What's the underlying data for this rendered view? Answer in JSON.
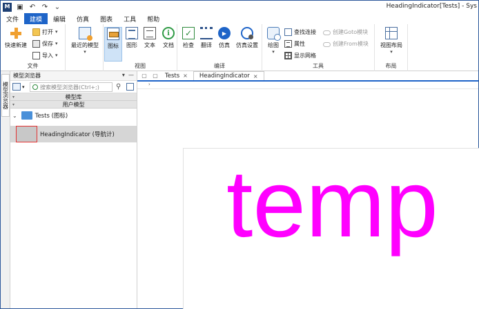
{
  "window": {
    "title": "HeadingIndicator[Tests] - Sys",
    "logo_letter": "M"
  },
  "menu": {
    "tabs": [
      {
        "label": "文件"
      },
      {
        "label": "建模"
      },
      {
        "label": "编辑"
      },
      {
        "label": "仿真"
      },
      {
        "label": "图表"
      },
      {
        "label": "工具"
      },
      {
        "label": "帮助"
      }
    ],
    "active_index": 1
  },
  "ribbon": {
    "file_group": {
      "label": "文件",
      "quick_new": "快速新建",
      "open": "打开",
      "save": "保存",
      "import": "导入",
      "recent_models": "最近的模型"
    },
    "view_group": {
      "label": "视图",
      "icon": "图标",
      "graph": "图形",
      "text": "文本",
      "doc": "文档"
    },
    "compile_group": {
      "label": "编译",
      "check": "检查",
      "translate": "翻译",
      "simulate": "仿真",
      "sim_settings": "仿真设置"
    },
    "tools_group": {
      "label": "工具",
      "draw": "绘图",
      "find_connection": "查找连接",
      "properties": "属性",
      "show_grid": "显示网格",
      "create_goto": "创建Goto模块",
      "create_from": "创建From模块"
    },
    "layout_group": {
      "label": "布局",
      "view_layout": "视图布局"
    }
  },
  "side_strip": {
    "tab_label": "模型浏览器"
  },
  "model_browser": {
    "title": "模型浏览器",
    "search_placeholder": "搜索模型浏览器(Ctrl+;)",
    "section_library": "模型库",
    "section_user": "用户模型",
    "folder_label": "Tests (图标)",
    "item_label": "HeadingIndicator (导航计)"
  },
  "editor": {
    "tabs": [
      {
        "label": "Tests"
      },
      {
        "label": "HeadingIndicator"
      }
    ],
    "active_tab": 1,
    "canvas_text": "temp"
  },
  "colors": {
    "accent": "#1e64c8",
    "canvas_text": "#ff00ff",
    "selection_border": "#e33030"
  }
}
